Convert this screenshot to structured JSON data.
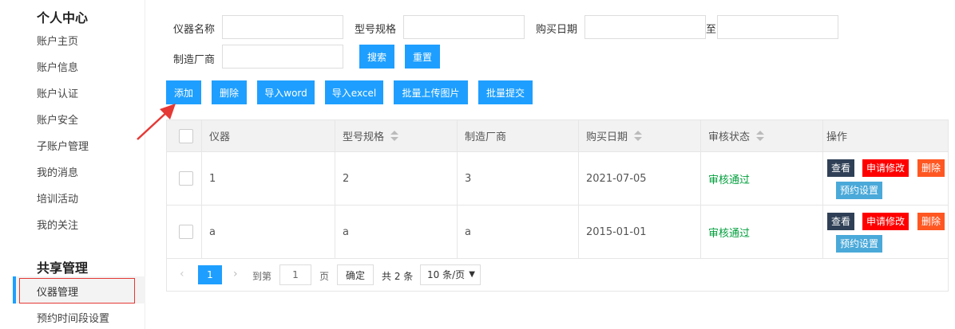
{
  "sidebar": {
    "personal_title": "个人中心",
    "personal_items": [
      "账户主页",
      "账户信息",
      "账户认证",
      "账户安全",
      "子账户管理",
      "我的消息",
      "培训活动",
      "我的关注"
    ],
    "share_title": "共享管理",
    "share_active": "仪器管理",
    "share_items": [
      "预约时间段设置"
    ]
  },
  "filters": {
    "name_label": "仪器名称",
    "model_label": "型号规格",
    "date_label": "购买日期",
    "to_label": "至",
    "maker_label": "制造厂商",
    "search_btn": "搜索",
    "reset_btn": "重置"
  },
  "toolbar": {
    "add": "添加",
    "delete": "删除",
    "import_word": "导入word",
    "import_excel": "导入excel",
    "batch_upload": "批量上传图片",
    "batch_submit": "批量提交"
  },
  "table": {
    "headers": [
      "仪器",
      "型号规格",
      "制造厂商",
      "购买日期",
      "审核状态",
      "操作"
    ],
    "rows": [
      {
        "instrument": "1",
        "model": "2",
        "maker": "3",
        "date": "2021-07-05",
        "status": "审核通过"
      },
      {
        "instrument": "a",
        "model": "a",
        "maker": "a",
        "date": "2015-01-01",
        "status": "审核通过"
      }
    ],
    "ops": {
      "view": "查看",
      "request_edit": "申请修改",
      "delete": "删除",
      "booking": "预约设置"
    }
  },
  "pager": {
    "current_page": "1",
    "goto_label": "到第",
    "page_input": "1",
    "page_unit": "页",
    "confirm": "确定",
    "total": "共 2 条",
    "page_size": "10 条/页"
  },
  "colors": {
    "accent": "#1e9fff",
    "arrow": "#e53935",
    "status_ok": "#009f3c"
  }
}
